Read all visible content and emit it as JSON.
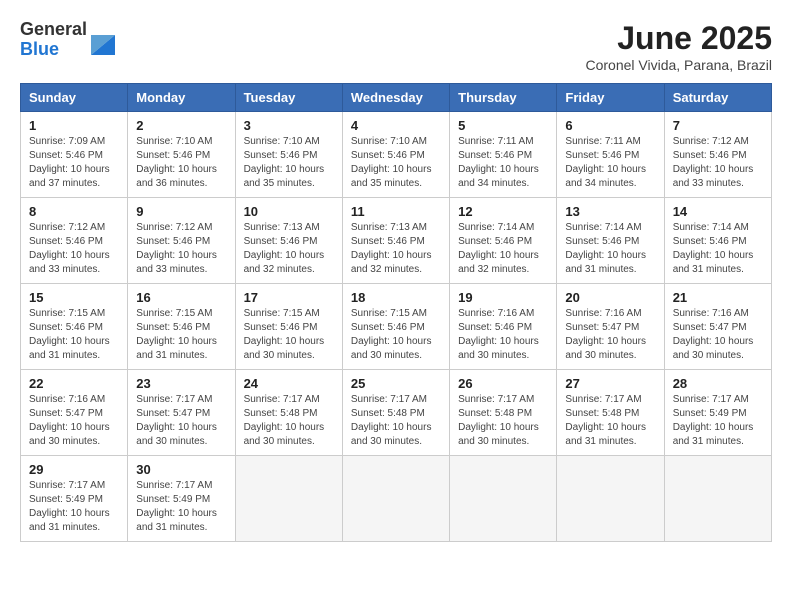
{
  "header": {
    "logo": {
      "general": "General",
      "blue": "Blue"
    },
    "title": "June 2025",
    "location": "Coronel Vivida, Parana, Brazil"
  },
  "columns": [
    "Sunday",
    "Monday",
    "Tuesday",
    "Wednesday",
    "Thursday",
    "Friday",
    "Saturday"
  ],
  "weeks": [
    [
      {
        "day": "1",
        "info": "Sunrise: 7:09 AM\nSunset: 5:46 PM\nDaylight: 10 hours\nand 37 minutes."
      },
      {
        "day": "2",
        "info": "Sunrise: 7:10 AM\nSunset: 5:46 PM\nDaylight: 10 hours\nand 36 minutes."
      },
      {
        "day": "3",
        "info": "Sunrise: 7:10 AM\nSunset: 5:46 PM\nDaylight: 10 hours\nand 35 minutes."
      },
      {
        "day": "4",
        "info": "Sunrise: 7:10 AM\nSunset: 5:46 PM\nDaylight: 10 hours\nand 35 minutes."
      },
      {
        "day": "5",
        "info": "Sunrise: 7:11 AM\nSunset: 5:46 PM\nDaylight: 10 hours\nand 34 minutes."
      },
      {
        "day": "6",
        "info": "Sunrise: 7:11 AM\nSunset: 5:46 PM\nDaylight: 10 hours\nand 34 minutes."
      },
      {
        "day": "7",
        "info": "Sunrise: 7:12 AM\nSunset: 5:46 PM\nDaylight: 10 hours\nand 33 minutes."
      }
    ],
    [
      {
        "day": "8",
        "info": "Sunrise: 7:12 AM\nSunset: 5:46 PM\nDaylight: 10 hours\nand 33 minutes."
      },
      {
        "day": "9",
        "info": "Sunrise: 7:12 AM\nSunset: 5:46 PM\nDaylight: 10 hours\nand 33 minutes."
      },
      {
        "day": "10",
        "info": "Sunrise: 7:13 AM\nSunset: 5:46 PM\nDaylight: 10 hours\nand 32 minutes."
      },
      {
        "day": "11",
        "info": "Sunrise: 7:13 AM\nSunset: 5:46 PM\nDaylight: 10 hours\nand 32 minutes."
      },
      {
        "day": "12",
        "info": "Sunrise: 7:14 AM\nSunset: 5:46 PM\nDaylight: 10 hours\nand 32 minutes."
      },
      {
        "day": "13",
        "info": "Sunrise: 7:14 AM\nSunset: 5:46 PM\nDaylight: 10 hours\nand 31 minutes."
      },
      {
        "day": "14",
        "info": "Sunrise: 7:14 AM\nSunset: 5:46 PM\nDaylight: 10 hours\nand 31 minutes."
      }
    ],
    [
      {
        "day": "15",
        "info": "Sunrise: 7:15 AM\nSunset: 5:46 PM\nDaylight: 10 hours\nand 31 minutes."
      },
      {
        "day": "16",
        "info": "Sunrise: 7:15 AM\nSunset: 5:46 PM\nDaylight: 10 hours\nand 31 minutes."
      },
      {
        "day": "17",
        "info": "Sunrise: 7:15 AM\nSunset: 5:46 PM\nDaylight: 10 hours\nand 30 minutes."
      },
      {
        "day": "18",
        "info": "Sunrise: 7:15 AM\nSunset: 5:46 PM\nDaylight: 10 hours\nand 30 minutes."
      },
      {
        "day": "19",
        "info": "Sunrise: 7:16 AM\nSunset: 5:46 PM\nDaylight: 10 hours\nand 30 minutes."
      },
      {
        "day": "20",
        "info": "Sunrise: 7:16 AM\nSunset: 5:47 PM\nDaylight: 10 hours\nand 30 minutes."
      },
      {
        "day": "21",
        "info": "Sunrise: 7:16 AM\nSunset: 5:47 PM\nDaylight: 10 hours\nand 30 minutes."
      }
    ],
    [
      {
        "day": "22",
        "info": "Sunrise: 7:16 AM\nSunset: 5:47 PM\nDaylight: 10 hours\nand 30 minutes."
      },
      {
        "day": "23",
        "info": "Sunrise: 7:17 AM\nSunset: 5:47 PM\nDaylight: 10 hours\nand 30 minutes."
      },
      {
        "day": "24",
        "info": "Sunrise: 7:17 AM\nSunset: 5:48 PM\nDaylight: 10 hours\nand 30 minutes."
      },
      {
        "day": "25",
        "info": "Sunrise: 7:17 AM\nSunset: 5:48 PM\nDaylight: 10 hours\nand 30 minutes."
      },
      {
        "day": "26",
        "info": "Sunrise: 7:17 AM\nSunset: 5:48 PM\nDaylight: 10 hours\nand 30 minutes."
      },
      {
        "day": "27",
        "info": "Sunrise: 7:17 AM\nSunset: 5:48 PM\nDaylight: 10 hours\nand 31 minutes."
      },
      {
        "day": "28",
        "info": "Sunrise: 7:17 AM\nSunset: 5:49 PM\nDaylight: 10 hours\nand 31 minutes."
      }
    ],
    [
      {
        "day": "29",
        "info": "Sunrise: 7:17 AM\nSunset: 5:49 PM\nDaylight: 10 hours\nand 31 minutes."
      },
      {
        "day": "30",
        "info": "Sunrise: 7:17 AM\nSunset: 5:49 PM\nDaylight: 10 hours\nand 31 minutes."
      },
      {
        "day": "",
        "info": ""
      },
      {
        "day": "",
        "info": ""
      },
      {
        "day": "",
        "info": ""
      },
      {
        "day": "",
        "info": ""
      },
      {
        "day": "",
        "info": ""
      }
    ]
  ]
}
